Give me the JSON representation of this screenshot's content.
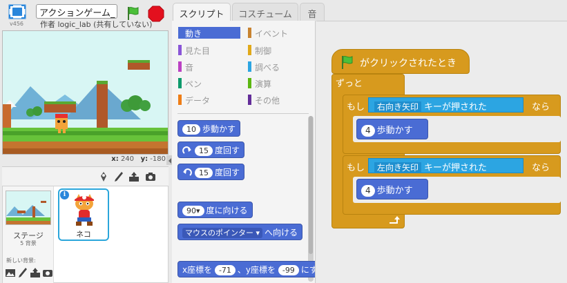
{
  "header": {
    "version": "v456",
    "project_title": "アクションゲーム_",
    "author_line": "作者 logic_lab (共有していない)"
  },
  "stage": {
    "x_label": "x:",
    "x_value": "240",
    "y_label": "y:",
    "y_value": "-180"
  },
  "sprites": {
    "stage_label": "ステージ",
    "backdrop_count": "5 背景",
    "new_backdrop_label": "新しい背景:",
    "sprite_name": "ネコ",
    "info_badge": "i"
  },
  "tabs": [
    {
      "label": "スクリプト",
      "active": true
    },
    {
      "label": "コスチューム",
      "active": false
    },
    {
      "label": "音",
      "active": false
    }
  ],
  "categories": [
    {
      "label": "動き",
      "color": "#4a6cd4",
      "active": true
    },
    {
      "label": "イベント",
      "color": "#c88330",
      "active": false
    },
    {
      "label": "見た目",
      "color": "#8a55d7",
      "active": false
    },
    {
      "label": "制御",
      "color": "#e1a91a",
      "active": false
    },
    {
      "label": "音",
      "color": "#bb42c3",
      "active": false
    },
    {
      "label": "調べる",
      "color": "#2ca5e2",
      "active": false
    },
    {
      "label": "ペン",
      "color": "#0e9a6c",
      "active": false
    },
    {
      "label": "演算",
      "color": "#5cb712",
      "active": false
    },
    {
      "label": "データ",
      "color": "#ee7d16",
      "active": false
    },
    {
      "label": "その他",
      "color": "#632d99",
      "active": false
    }
  ],
  "palette_blocks": {
    "move_value": "10",
    "move_label": "歩動かす",
    "turn_right_value": "15",
    "turn_right_label": "度回す",
    "turn_left_value": "15",
    "turn_left_label": "度回す",
    "point_dir_value": "90▾",
    "point_dir_label": "度に向ける",
    "point_towards_value": "マウスのポインター ▾",
    "point_towards_label": "へ向ける",
    "goto_x_label": "x座標を",
    "goto_x_value": "-71",
    "goto_y_label": "、y座標を",
    "goto_y_value": "-99",
    "goto_tail": "にする"
  },
  "script": {
    "hat_label": "がクリックされたとき",
    "forever_label": "ずっと",
    "if1": {
      "if_word": "もし",
      "key": "右向き矢印",
      "key_suffix": "キーが押された",
      "then_word": "なら",
      "move_value": "4",
      "move_label": "歩動かす"
    },
    "if2": {
      "if_word": "もし",
      "key": "左向き矢印",
      "key_suffix": "キーが押された",
      "then_word": "なら",
      "move_value": "4",
      "move_label": "歩動かす"
    }
  },
  "colors": {
    "motion": "#4a6cd4",
    "control": "#d79a1e",
    "sensing": "#2ca5e2",
    "events": "#c88330"
  }
}
